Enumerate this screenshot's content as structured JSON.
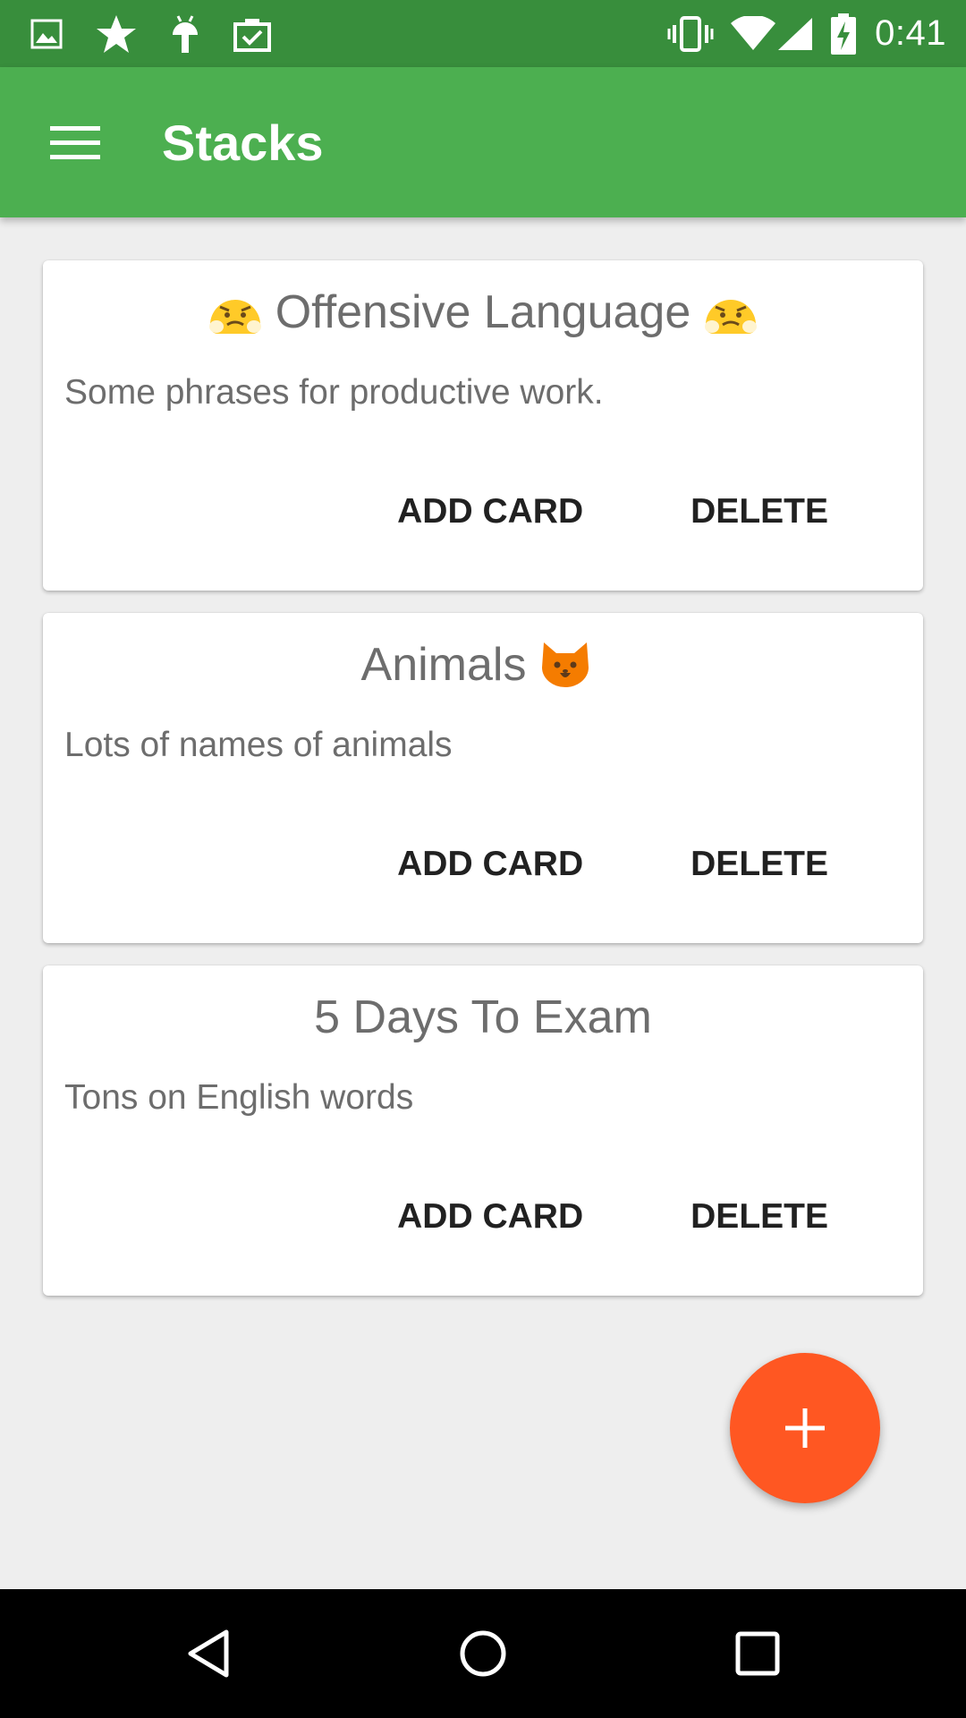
{
  "status_bar": {
    "time": "0:41",
    "left_icons": [
      "image-icon",
      "star-icon",
      "android-icon",
      "clipboard-check-icon"
    ],
    "right_icons": [
      "vibrate-icon",
      "wifi-icon",
      "signal-icon",
      "battery-charging-icon"
    ]
  },
  "app_bar": {
    "title": "Stacks",
    "menu_icon": "hamburger-menu-icon",
    "color": "#4caf50",
    "status_color": "#388e3c"
  },
  "stacks": [
    {
      "title": "Offensive Language",
      "emoji": "confounded-face",
      "description": "Some phrases for productive work.",
      "add_label": "ADD CARD",
      "delete_label": "DELETE"
    },
    {
      "title": "Animals",
      "emoji": "cat-face",
      "description": "Lots of names of animals",
      "add_label": "ADD CARD",
      "delete_label": "DELETE"
    },
    {
      "title": "5 Days To Exam",
      "description": "Tons on English words",
      "add_label": "ADD CARD",
      "delete_label": "DELETE"
    }
  ],
  "fab": {
    "icon": "plus-icon",
    "color": "#ff5722"
  },
  "nav_bar": {
    "icons": [
      "back-icon",
      "home-icon",
      "recents-icon"
    ]
  }
}
